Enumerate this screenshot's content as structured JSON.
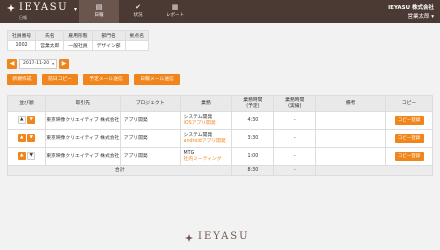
{
  "header": {
    "logo_text": "IEYASU",
    "logo_sub": "日報",
    "logo_caret": "▾",
    "tabs": [
      {
        "label": "日報",
        "icon": "document-icon"
      },
      {
        "label": "状況",
        "icon": "check-icon"
      },
      {
        "label": "レポート",
        "icon": "report-icon"
      }
    ],
    "company": "IEYASU 株式会社",
    "user": "営業太郎 ▾"
  },
  "employee": {
    "headers": [
      "社員番号",
      "氏名",
      "雇用形態",
      "部門名",
      "拠点名"
    ],
    "values": [
      "1002",
      "営業太郎",
      "一般社員",
      "デザイン部",
      ""
    ]
  },
  "date_nav": {
    "prev": "◀",
    "date": "2017-11-20",
    "caret": "▾",
    "next": "▶"
  },
  "actions": {
    "new": "新規作成",
    "copy_prev": "前日コピー",
    "plan_mail": "予定メール送信",
    "daily_mail": "日報メール送信"
  },
  "table": {
    "headers": {
      "order": "並び順",
      "client": "取引先",
      "project": "プロジェクト",
      "task": "業務",
      "planned": "業務時間",
      "planned_sub": "(予定)",
      "actual": "業務時間",
      "actual_sub": "(実績)",
      "notes": "備考",
      "copy": "コピー"
    },
    "rows": [
      {
        "up": "▲",
        "down": "▼",
        "client": "東京映像クリエイティブ 株式会社",
        "project": "アプリ開発",
        "task": "システム開発",
        "sub": "iOSアプリ開発",
        "planned": "4:30",
        "actual": "-",
        "notes": "",
        "copy": "コピー登録"
      },
      {
        "up": "▲",
        "down": "▼",
        "client": "東京映像クリエイティブ 株式会社",
        "project": "アプリ開発",
        "task": "システム開発",
        "sub": "androidアプリ開発",
        "planned": "3:30",
        "actual": "-",
        "notes": "",
        "copy": "コピー登録"
      },
      {
        "up": "▲",
        "down": "▼",
        "client": "東京映像クリエイティブ 株式会社",
        "project": "アプリ開発",
        "task": "MTG",
        "sub": "社内ミーティング",
        "planned": "1:00",
        "actual": "-",
        "notes": "",
        "copy": "コピー登録"
      }
    ],
    "total_label": "合計",
    "total_planned": "8:30",
    "total_actual": "-"
  },
  "footer": {
    "logo_text": "IEYASU"
  },
  "colors": {
    "accent": "#f0861b",
    "topbar": "#4b3a34",
    "topbar_active": "#6b564e"
  }
}
